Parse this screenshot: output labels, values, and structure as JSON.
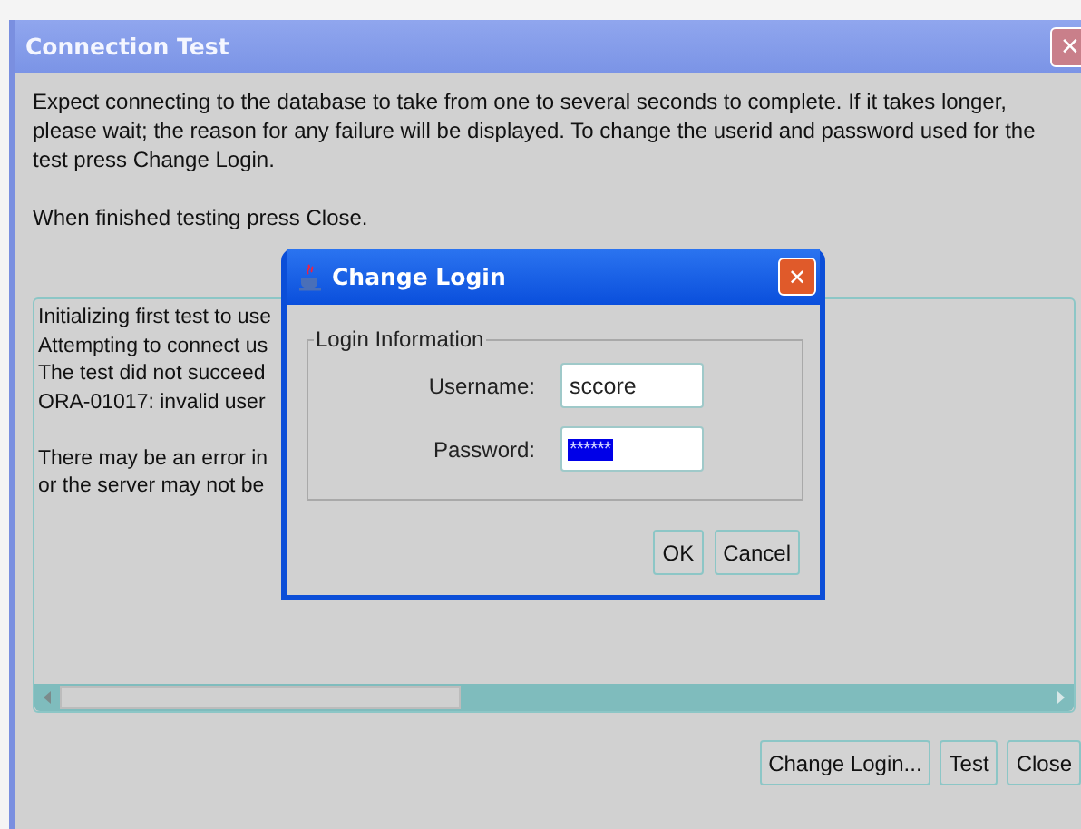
{
  "window": {
    "title": "Connection Test",
    "close": "✕"
  },
  "description": "Expect connecting to the database to take from one to several seconds to complete. If it takes longer, please wait; the reason for any failure will be displayed. To change the userid and password used for the test press Change Login.",
  "hint": "When finished testing press Close.",
  "log": [
    [
      "Initializing first test to use",
      "Attempting to connect us",
      "The test did not succeed",
      "ORA-01017: invalid user"
    ],
    [
      "There may be an error in",
      "or the server may not be"
    ]
  ],
  "buttons": [
    "Change Login...",
    "Test",
    "Close"
  ],
  "dialog": {
    "title": "Change Login",
    "close": "✕",
    "group": "Login Information",
    "fields": [
      {
        "label": "Username:",
        "value": "sccore",
        "kind": "text",
        "selected": false
      },
      {
        "label": "Password:",
        "value": "******",
        "kind": "password",
        "selected": true
      }
    ],
    "buttons": [
      "OK",
      "Cancel"
    ]
  }
}
